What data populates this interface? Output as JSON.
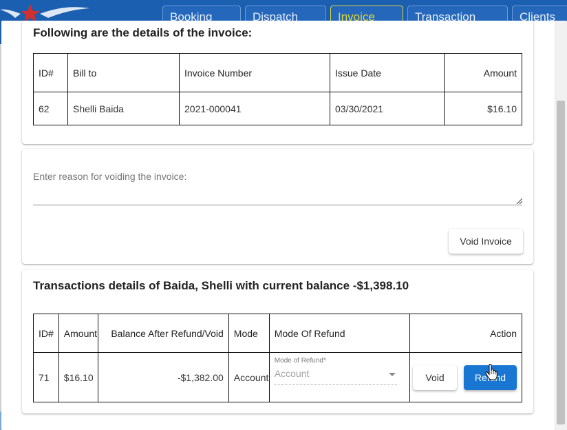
{
  "app_bar": {
    "nav_tabs": [
      "Booking",
      "Dispatch",
      "Invoice",
      "Transaction",
      "Clients"
    ]
  },
  "invoice_card": {
    "heading": "Following are the details of the invoice:",
    "columns": [
      "ID#",
      "Bill to",
      "Invoice Number",
      "Issue Date",
      "Amount"
    ],
    "row": {
      "id": "62",
      "bill_to": "Shelli Baida",
      "invoice_number": "2021-000041",
      "issue_date": "03/30/2021",
      "amount": "$16.10"
    }
  },
  "void_card": {
    "reason_placeholder": "Enter reason for voiding the invoice:",
    "void_invoice_label": "Void Invoice"
  },
  "transactions_card": {
    "heading": "Transactions details of Baida, Shelli with current balance -$1,398.10",
    "columns": [
      "ID#",
      "Amount",
      "Balance After Refund/Void",
      "Mode",
      "Mode Of Refund",
      "Action"
    ],
    "row": {
      "id": "71",
      "amount": "$16.10",
      "balance_after": "-$1,382.00",
      "mode": "Account",
      "mode_of_refund_label": "Mode of Refund*",
      "mode_of_refund_value": "Account",
      "void_label": "Void",
      "refund_label": "Refund"
    }
  },
  "colors": {
    "accent": "#1976d2",
    "app_bar": "#1b5fb0",
    "active_tab": "#e0d53a"
  }
}
